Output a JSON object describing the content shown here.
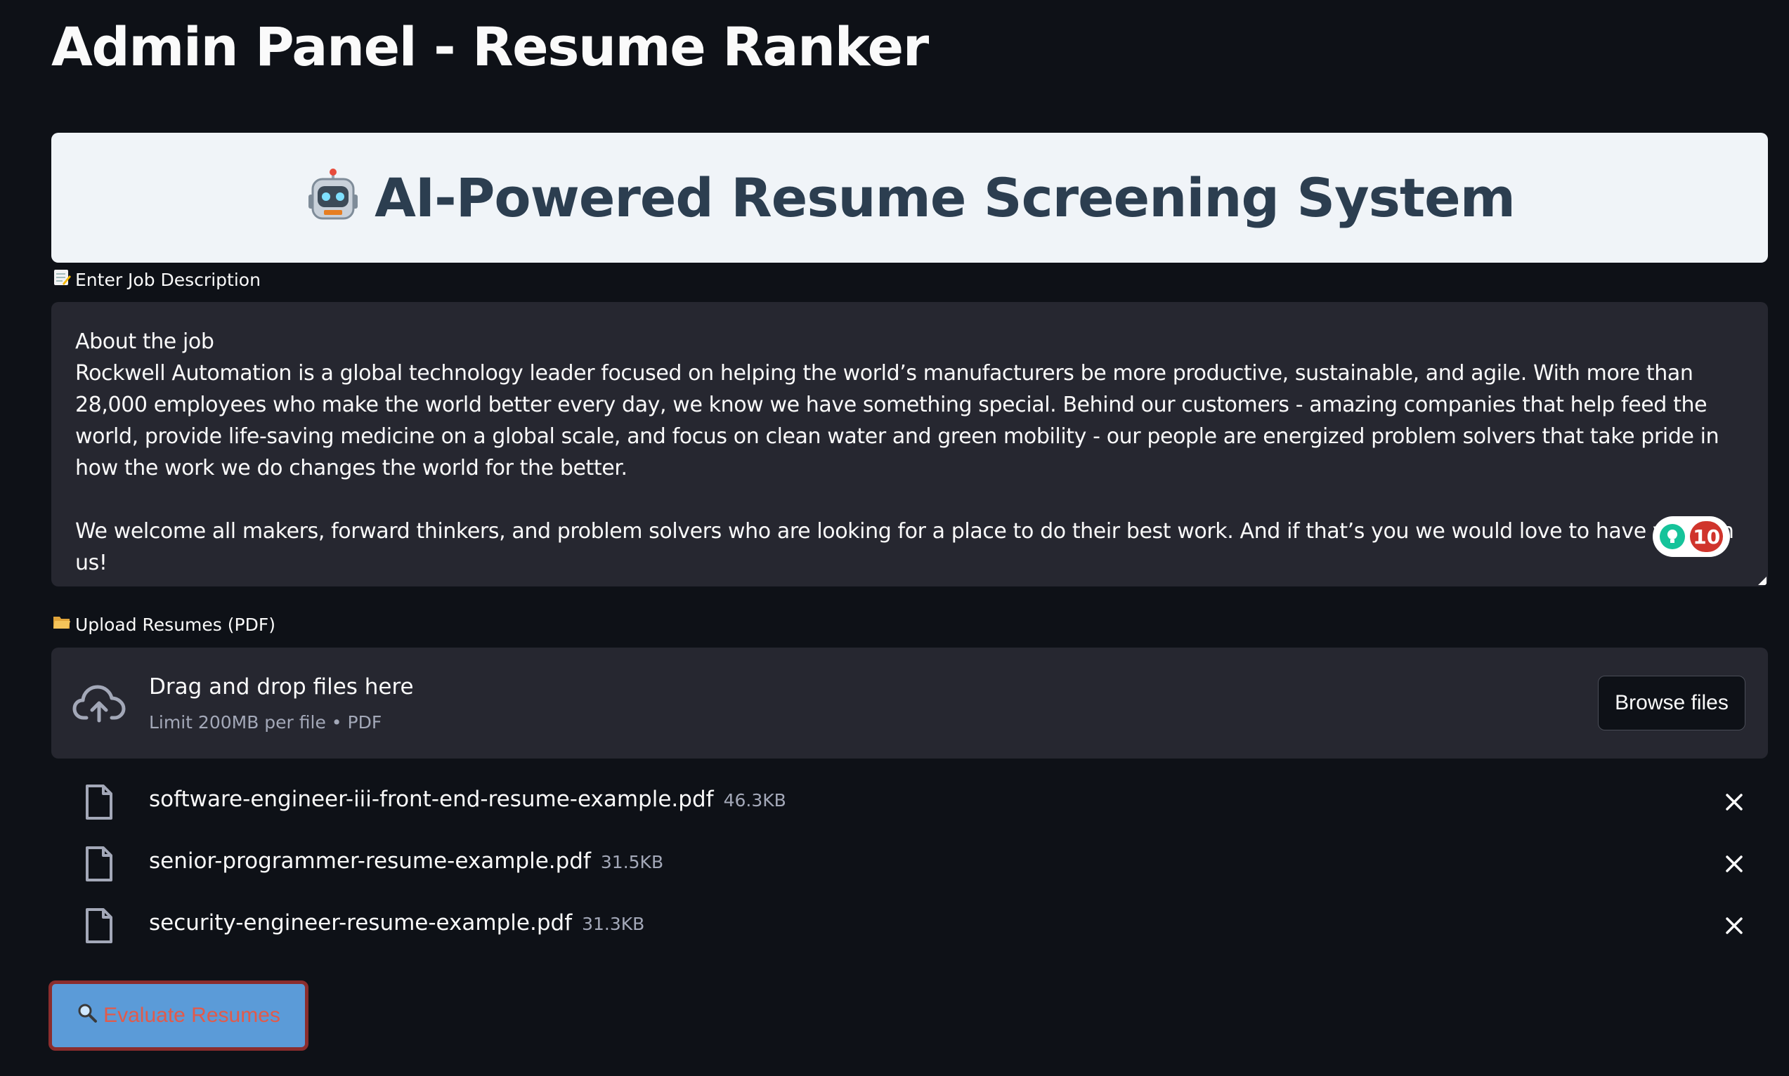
{
  "page": {
    "title": "Admin Panel - Resume Ranker"
  },
  "banner": {
    "emoji": "🤖",
    "title": "AI-Powered Resume Screening System"
  },
  "job_description": {
    "label_emoji": "📝",
    "label": "Enter Job Description",
    "value": "About the job\nRockwell Automation is a global technology leader focused on helping the world’s manufacturers be more productive, sustainable, and agile. With more than 28,000 employees who make the world better every day, we know we have something special. Behind our customers - amazing companies that help feed the world, provide life-saving medicine on a global scale, and focus on clean water and green mobility - our people are energized problem solvers that take pride in how the work we do changes the world for the better.\n\nWe welcome all makers, forward thinkers, and problem solvers who are looking for a place to do their best work. And if that’s you we would love to have you join us!\n\nJob Description",
    "grammarly_count": "10"
  },
  "upload": {
    "label_emoji": "📂",
    "label": "Upload Resumes (PDF)",
    "dropzone_title": "Drag and drop files here",
    "dropzone_subtitle": "Limit 200MB per file • PDF",
    "browse_label": "Browse files"
  },
  "files": [
    {
      "name": "software-engineer-iii-front-end-resume-example.pdf",
      "size": "46.3KB"
    },
    {
      "name": "senior-programmer-resume-example.pdf",
      "size": "31.5KB"
    },
    {
      "name": "security-engineer-resume-example.pdf",
      "size": "31.3KB"
    }
  ],
  "actions": {
    "evaluate_emoji": "🔍",
    "evaluate_label": "Evaluate Resumes"
  },
  "colors": {
    "background": "#0e1117",
    "panel": "#262730",
    "banner": "#f0f4f8",
    "banner_text": "#2c3e50",
    "evaluate_button": "#5b9bd8",
    "evaluate_border": "#8b2d2d",
    "evaluate_text": "#e25a4a"
  }
}
